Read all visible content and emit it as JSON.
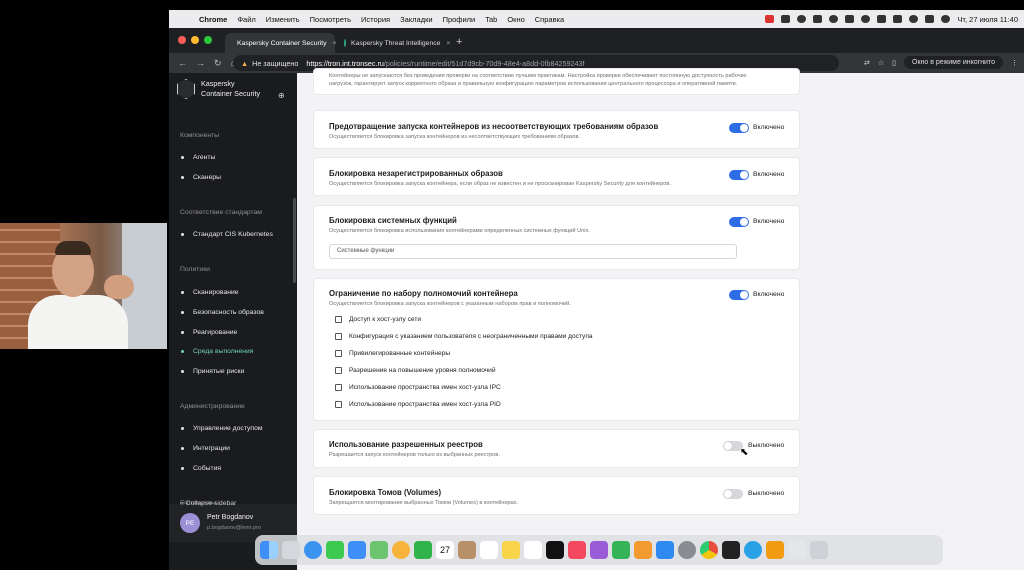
{
  "menubar": {
    "app": "Chrome",
    "items": [
      "Файл",
      "Изменить",
      "Посмотреть",
      "История",
      "Закладки",
      "Профили",
      "Tab",
      "Окно",
      "Справка"
    ],
    "clock": "Чт, 27 июля  11:40"
  },
  "tabs": [
    {
      "label": "Kaspersky Container Security",
      "close": "×"
    },
    {
      "label": "Kaspersky Threat Intelligence",
      "close": "×"
    }
  ],
  "addressbar": {
    "warning": "Не защищено",
    "url_host": "https://tron.int.tronsec.ru",
    "url_path": "/policies/runtime/edit/51d7d9cb-70d9-48e4-a8dd-0fb84259243f",
    "incognito": "Окно в режиме инкогнито"
  },
  "sidebar": {
    "brand_line1": "Kaspersky",
    "brand_line2": "Container Security",
    "sections": [
      {
        "title": "Компоненты",
        "items": [
          "Агенты",
          "Сканеры"
        ]
      },
      {
        "title": "Соответствие стандартам",
        "items": [
          "Стандарт CIS Kubernetes"
        ]
      },
      {
        "title": "Политики",
        "items": [
          "Сканирование",
          "Безопасность образов",
          "Реагирование",
          "Среда выполнения",
          "Принятые риски"
        ]
      },
      {
        "title": "Администрирование",
        "items": [
          "Управление доступом",
          "Интеграции",
          "События"
        ]
      },
      {
        "title": "Параметры",
        "items": []
      }
    ],
    "active_item": "Среда выполнения",
    "user": {
      "initials": "PE",
      "name": "Petr Bogdanov",
      "email": "p.bogdanov@lemi.pro"
    },
    "collapse": "Collapse sidebar"
  },
  "content": {
    "top_text_line1": "Контейнеры не запускаются без проведения проверки на соответствие лучшим практикам. Настройка проверки обеспечивает постоянную доступность рабочих",
    "top_text_line2": "нагрузок, гарантирует запуск корректного образа и правильную конфигурацию параметров использования центрального процессора и оперативной памяти.",
    "cards": [
      {
        "title": "Предотвращение запуска контейнеров из несоответствующих требованиям образов",
        "desc": "Осуществляется блокировка запуска контейнеров из несоответствующих требованиям образов.",
        "state": "Включено",
        "on": true
      },
      {
        "title": "Блокировка незарегистрированных образов",
        "desc": "Осуществляется блокировка запуска контейнера, если образ не известен и не просканирован Kaspersky Security для контейнеров.",
        "state": "Включено",
        "on": true
      },
      {
        "title": "Блокировка системных функций",
        "desc": "Осуществляется блокировка использования контейнерами определенных системных функций Unix.",
        "state": "Включено",
        "on": true,
        "input": "Системные функции"
      },
      {
        "title": "Ограничение по набору полномочий контейнера",
        "desc": "Осуществляется блокировка запуска контейнеров с указанным набором прав и полномочий.",
        "state": "Включено",
        "on": true,
        "checkboxes": [
          "Доступ к хост-узлу сети",
          "Конфигурация с указанием пользователя с неограниченными правами доступа",
          "Привилегированные контейнеры",
          "Разрешение на повышение уровня полномочий",
          "Использование пространства имен хост-узла IPC",
          "Использование пространства имен хост-узла PID"
        ]
      },
      {
        "title": "Использование разрешенных реестров",
        "desc": "Разрешается запуск контейнеров только из выбранных реестров.",
        "state": "Выключено",
        "on": false
      },
      {
        "title": "Блокировка Томов (Volumes)",
        "desc": "Запрещается монтирование выбранных Томов (Volumes) в контейнерах.",
        "state": "Выключено",
        "on": false
      }
    ]
  },
  "colors": {
    "toggle_on": "#2e6ce6",
    "active_nav": "#6fd3b0",
    "sidebar_bg": "#1a1b1e"
  },
  "dock_icons": [
    "finder-icon",
    "launchpad-icon",
    "safari-icon",
    "messages-icon",
    "mail-icon",
    "maps-icon",
    "photos-icon",
    "facetime-icon",
    "calendar-icon",
    "contacts-icon",
    "reminders-icon",
    "notes-icon",
    "freeform-icon",
    "tv-icon",
    "music-icon",
    "podcasts-icon",
    "numbers-icon",
    "pages-icon",
    "appstore-icon",
    "settings-icon",
    "chrome-icon",
    "terminal-icon",
    "telegram-icon",
    "app-icon",
    "downloads-icon",
    "trash-icon"
  ],
  "dock_calendar_day": "27"
}
